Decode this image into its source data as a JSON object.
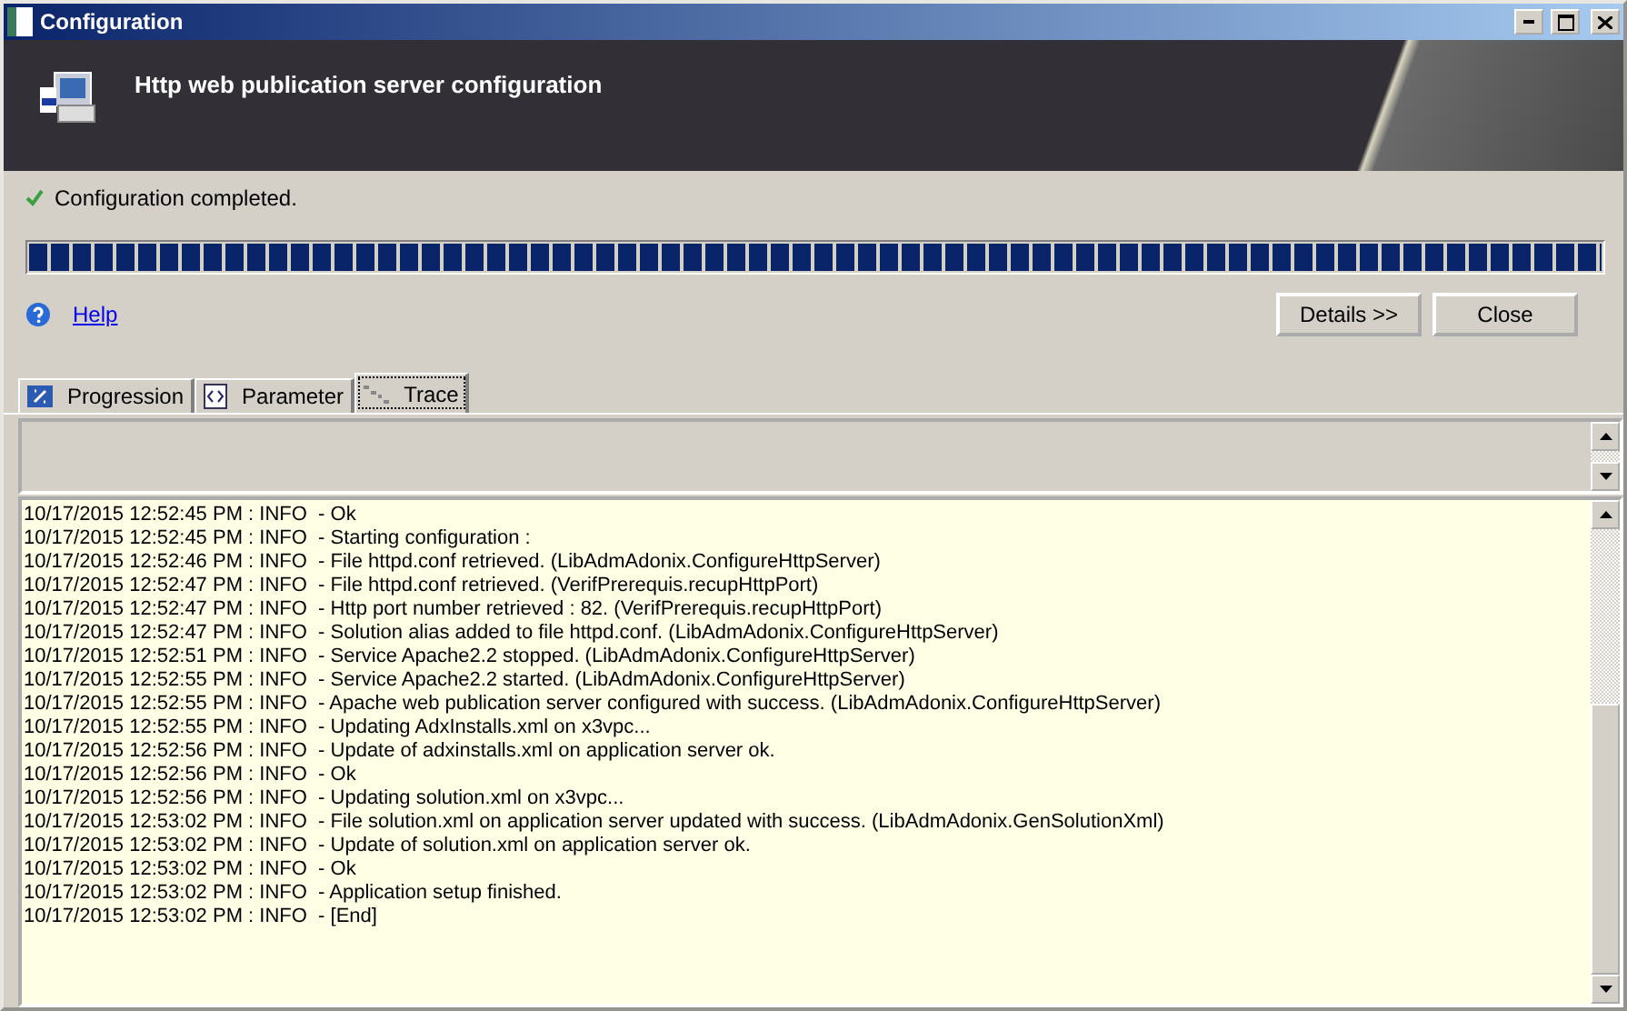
{
  "window": {
    "title": "Configuration"
  },
  "header": {
    "title": "Http web publication server configuration"
  },
  "status": {
    "text": "Configuration completed."
  },
  "progress": {
    "level": 1
  },
  "help_link": "Help",
  "buttons": [
    "Details >>",
    "Close"
  ],
  "tabs": [
    {
      "label": "Progression",
      "kind": "progress",
      "selected": false
    },
    {
      "label": "Parameter",
      "kind": "code",
      "selected": false
    },
    {
      "label": "Trace",
      "kind": "trace",
      "selected": true
    }
  ],
  "log": [
    "10/17/2015 12:52:45 PM : INFO  - Ok",
    "10/17/2015 12:52:45 PM : INFO  - Starting configuration :",
    "10/17/2015 12:52:46 PM : INFO  - File httpd.conf retrieved. (LibAdmAdonix.ConfigureHttpServer)",
    "10/17/2015 12:52:47 PM : INFO  - File httpd.conf retrieved. (VerifPrerequis.recupHttpPort)",
    "10/17/2015 12:52:47 PM : INFO  - Http port number retrieved : 82. (VerifPrerequis.recupHttpPort)",
    "10/17/2015 12:52:47 PM : INFO  - Solution alias added to file httpd.conf. (LibAdmAdonix.ConfigureHttpServer)",
    "10/17/2015 12:52:51 PM : INFO  - Service Apache2.2 stopped. (LibAdmAdonix.ConfigureHttpServer)",
    "10/17/2015 12:52:55 PM : INFO  - Service Apache2.2 started. (LibAdmAdonix.ConfigureHttpServer)",
    "10/17/2015 12:52:55 PM : INFO  - Apache web publication server configured with success. (LibAdmAdonix.ConfigureHttpServer)",
    "10/17/2015 12:52:55 PM : INFO  - Updating AdxInstalls.xml on x3vpc...",
    "10/17/2015 12:52:56 PM : INFO  - Update of adxinstalls.xml on application server ok.",
    "10/17/2015 12:52:56 PM : INFO  - Ok",
    "10/17/2015 12:52:56 PM : INFO  - Updating solution.xml on x3vpc...",
    "10/17/2015 12:53:02 PM : INFO  - File solution.xml on application server updated with success. (LibAdmAdonix.GenSolutionXml)",
    "10/17/2015 12:53:02 PM : INFO  - Update of solution.xml on application server ok.",
    "10/17/2015 12:53:02 PM : INFO  - Ok",
    "10/17/2015 12:53:02 PM : INFO  - Application setup finished.",
    "10/17/2015 12:53:02 PM : INFO  - [End]"
  ]
}
